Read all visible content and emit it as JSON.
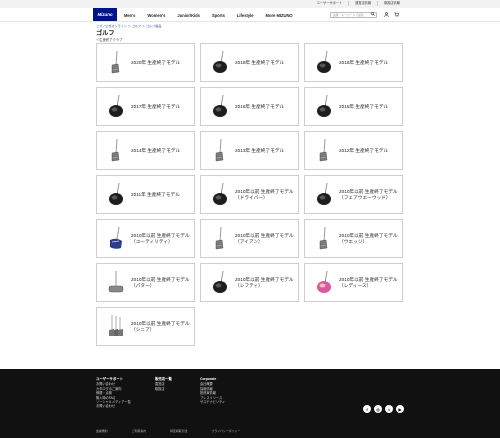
{
  "utility_bar": {
    "links": [
      "ユーザーサポート",
      "運営店情報",
      "取扱店情報"
    ]
  },
  "header": {
    "logo_text": "Mizuno",
    "nav": [
      "Men's",
      "Women's",
      "Junior/Kids",
      "Sports",
      "Lifestyle",
      "More MIZUNO"
    ],
    "search_placeholder": "品番・キーワードで検索"
  },
  "breadcrumb": "ミズノ公式オンライン ＞ ゴルフ ＞ ゴルフ製品",
  "page_title": "ゴルフ",
  "back_link": "＜生産終了クラブ",
  "products": [
    {
      "label": "2020年 生産終了モデル",
      "icon": "iron-icon"
    },
    {
      "label": "2019年 生産終了モデル",
      "icon": "driver-icon"
    },
    {
      "label": "2018年 生産終了モデル",
      "icon": "driver-icon"
    },
    {
      "label": "2017年 生産終了モデル",
      "icon": "driver-icon"
    },
    {
      "label": "2016年 生産終了モデル",
      "icon": "driver-icon"
    },
    {
      "label": "2015年 生産終了モデル",
      "icon": "driver-icon"
    },
    {
      "label": "2014年 生産終了モデル",
      "icon": "iron-icon"
    },
    {
      "label": "2013年 生産終了モデル",
      "icon": "iron-icon"
    },
    {
      "label": "2012年 生産終了モデル",
      "icon": "iron-icon"
    },
    {
      "label": "2011年 生産終了モデル",
      "icon": "driver-icon"
    },
    {
      "label": "2010年以前 生産終了モデル\n（ドライバー）",
      "icon": "driver-icon"
    },
    {
      "label": "2010年以前 生産終了モデル\n（フェアウエーウッド）",
      "icon": "driver-icon"
    },
    {
      "label": "2010年以前 生産終了モデル\n（ユーティリティ）",
      "icon": "utility-icon"
    },
    {
      "label": "2010年以前 生産終了モデル\n（アイアン）",
      "icon": "iron-icon"
    },
    {
      "label": "2010年以前 生産終了モデル\n（ウエッジ）",
      "icon": "iron-icon"
    },
    {
      "label": "2010年以前 生産終了モデル\n（パター）",
      "icon": "putter-icon"
    },
    {
      "label": "2010年以前 生産終了モデル\n（レフティ）",
      "icon": "driver-icon"
    },
    {
      "label": "2010年以前 生産終了モデル\n（レディース）",
      "icon": "driver-pink-icon"
    },
    {
      "label": "2010年以前 生産終了モデル\n（シニア）",
      "icon": "iron-set-icon"
    }
  ],
  "footer": {
    "columns": [
      {
        "heading": "ユーザーサポート",
        "items": [
          "お問い合わせ",
          "カタログのご案内",
          "修理・点検",
          "購入時のFAQ",
          "ソーシャルメディア一覧",
          "お問い合わせ"
        ]
      },
      {
        "heading": "販売店一覧",
        "items": [
          "直営店",
          "取扱店"
        ]
      },
      {
        "heading": "Corporate",
        "items": [
          "会社概要",
          "採用情報",
          "投資家情報",
          "プレスリリース",
          "サステナビリティ"
        ]
      }
    ],
    "social": [
      "f",
      "◎",
      "t",
      "▶"
    ],
    "bottom_links": [
      "会員規約",
      "ご利用案内",
      "特定商取引法",
      "プライバシーポリシー"
    ]
  },
  "colors": {
    "brand": "#001489",
    "footer_bg": "#111111",
    "card_border": "#cfcfcf"
  }
}
